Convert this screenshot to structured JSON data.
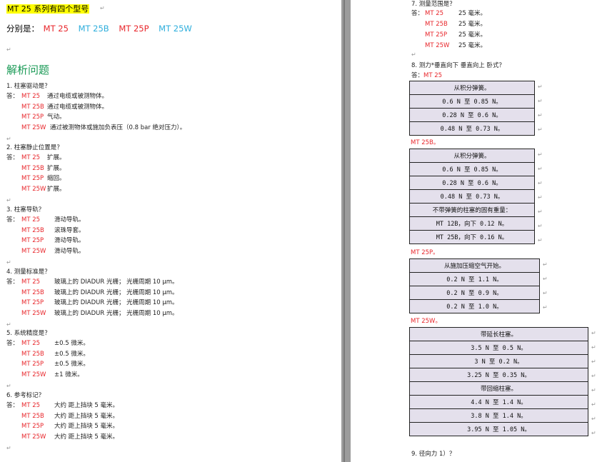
{
  "left": {
    "title": "MT 25 系列有四个型号",
    "models_label": "分别是：",
    "models": [
      {
        "name": "MT 25",
        "color": "#e8262b"
      },
      {
        "name": "MT 25B",
        "color": "#2eaedc"
      },
      {
        "name": "MT 25P",
        "color": "#e8262b"
      },
      {
        "name": "MT 25W",
        "color": "#2eaedc"
      }
    ],
    "section": "解析问题",
    "questions": [
      {
        "q": "1.   柱塞驱动是？",
        "rows": [
          {
            "model": "MT 25",
            "text": "通过电缆或被测物体。"
          },
          {
            "model": "MT 25B",
            "text": "通过电缆或被测物体。"
          },
          {
            "model": "MT 25P",
            "text": "气动。"
          },
          {
            "model": "MT 25W",
            "text": "通过被测物体或施加负表压（0.8  bar 绝对压力）。"
          }
        ]
      },
      {
        "q": "2.   柱塞静止位置是？",
        "rows": [
          {
            "model": "MT 25",
            "text": "扩展。"
          },
          {
            "model": "MT 25B",
            "text": "扩展。"
          },
          {
            "model": "MT 25P",
            "text": "缩回。"
          },
          {
            "model": "MT 25W",
            "text": "扩展。"
          }
        ]
      },
      {
        "q": "3.   柱塞导轨？",
        "rows": [
          {
            "model": "MT 25",
            "text": "滑动导轨。"
          },
          {
            "model": "MT 25B",
            "text": "滚珠导套。"
          },
          {
            "model": "MT 25P",
            "text": "滑动导轨。"
          },
          {
            "model": "MT 25W",
            "text": "滑动导轨。"
          }
        ]
      },
      {
        "q": "4.   测量标准是？",
        "rows": [
          {
            "model": "MT 25",
            "text": "玻璃上的 DIADUR 光栅；   光栅周期 10 μm。"
          },
          {
            "model": "MT 25B",
            "text": "玻璃上的 DIADUR 光栅；   光栅周期 10 μm。"
          },
          {
            "model": "MT 25P",
            "text": "玻璃上的 DIADUR 光栅；   光栅周期 10 μm。"
          },
          {
            "model": "MT 25W",
            "text": "玻璃上的 DIADUR 光栅；   光栅周期 10 μm。"
          }
        ]
      },
      {
        "q": "5.   系统精度是？",
        "rows": [
          {
            "model": "MT 25",
            "text": "±0.5 微米。"
          },
          {
            "model": "MT 25B",
            "text": "±0.5 微米。"
          },
          {
            "model": "MT 25P",
            "text": "±0.5 微米。"
          },
          {
            "model": "MT 25W",
            "text": "±1 微米。"
          }
        ]
      },
      {
        "q": "6.   参考标记？",
        "rows": [
          {
            "model": "MT 25",
            "text": "大约  距上挡块 5 毫米。"
          },
          {
            "model": "MT 25B",
            "text": "大约  距上挡块 5 毫米。"
          },
          {
            "model": "MT 25P",
            "text": "大约  距上挡块 5 毫米。"
          },
          {
            "model": "MT 25W",
            "text": "大约  距上挡块 5 毫米。"
          }
        ]
      }
    ],
    "answer_label": "答："
  },
  "right": {
    "q7": "7.   测量范围是？",
    "q7_rows": [
      {
        "model": "MT 25",
        "text": "25 毫米。"
      },
      {
        "model": "MT 25B",
        "text": "25 毫米。"
      },
      {
        "model": "MT 25P",
        "text": "25 毫米。"
      },
      {
        "model": "MT 25W",
        "text": "25 毫米。"
      }
    ],
    "q8": "8.   测力*垂直向下   垂直向上   卧式？",
    "q8_first_model": "MT 25",
    "tables": [
      {
        "model": "",
        "cells": [
          "从积分弹簧。",
          "0.6 N 至 0.85 N。",
          "0.28 N 至 0.6 N。",
          "0.48 N 至 0.73 N。"
        ]
      },
      {
        "model": "MT 25B。",
        "cells": [
          "从积分弹簧。",
          "0.6 N 至 0.85 N。",
          "0.28 N 至 0.6 N。",
          "0.48 N 至 0.73 N。",
          "不带弹簧的柱塞的固有重量：",
          "MT 12B，向下 0.12 N。",
          "MT 25B，向下 0.16 N。"
        ]
      },
      {
        "model": "MT 25P。",
        "cells": [
          "从施加压缩空气开始。",
          "0.2 N 至 1.1 N。",
          "0.2 N 至 0.9 N。",
          "0.2 N 至 1.0 N。"
        ]
      },
      {
        "model": "MT 25W。",
        "cells": [
          "带延长柱塞。",
          "3.5 N 至 0.5 N。",
          "3 N 至 0.2 N。",
          "3.25 N 至 0.35 N。",
          "带回缩柱塞。",
          "4.4 N 至 1.4 N。",
          "3.8 N 至 1.4 N。",
          "3.95 N 至 1.05 N。"
        ]
      }
    ],
    "q9": "9.   径向力 1）？"
  },
  "colors": {
    "model_red": "#e8262b",
    "model_cyan": "#2eaedc",
    "heading_green": "#1a9a56",
    "table_fill": "#e4e0ec",
    "highlight": "#ffff00"
  }
}
